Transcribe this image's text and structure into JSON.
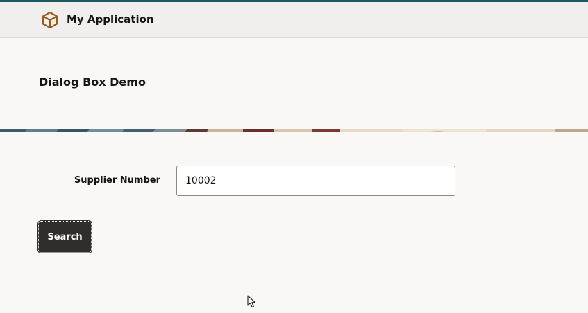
{
  "app": {
    "title": "My Application",
    "logo_icon": "cube-icon",
    "accent_color": "#1f5964",
    "logo_color": "#9a5a1a"
  },
  "page": {
    "title": "Dialog Box Demo"
  },
  "form": {
    "supplier_label": "Supplier Number",
    "supplier_value": "10002"
  },
  "actions": {
    "search_label": "Search",
    "button_color": "#312d2a"
  }
}
